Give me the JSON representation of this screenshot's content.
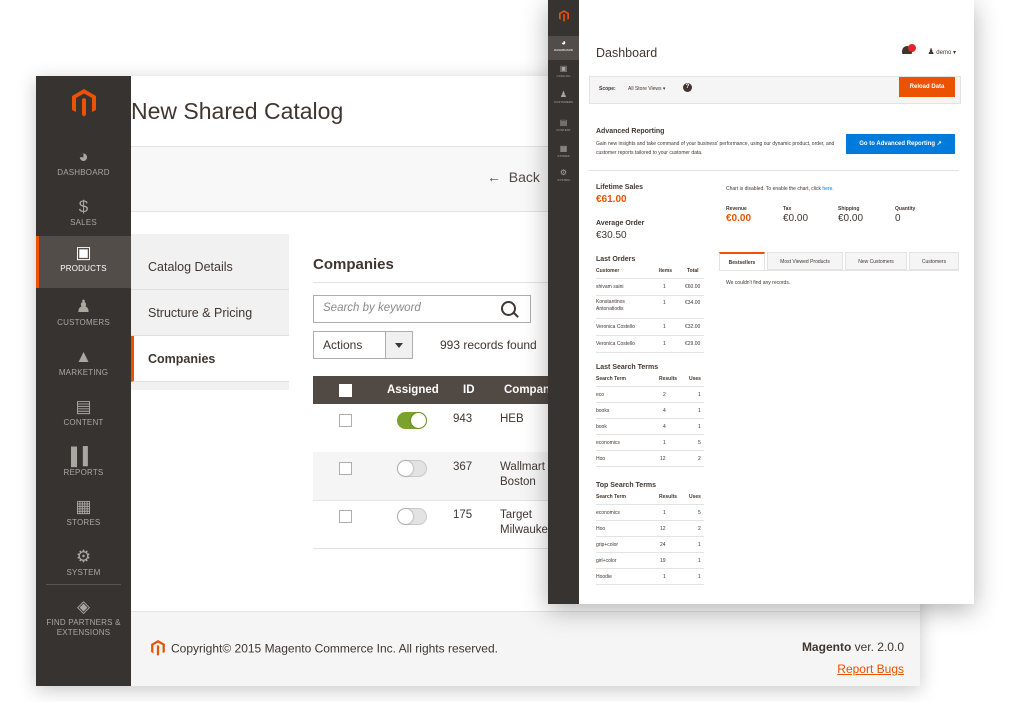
{
  "catalog_window": {
    "title": "New Shared Catalog",
    "back_label": "Back",
    "nav": [
      {
        "label": "DASHBOARD",
        "icon": "dashboard-icon"
      },
      {
        "label": "SALES",
        "icon": "dollar-icon"
      },
      {
        "label": "PRODUCTS",
        "icon": "cube-icon"
      },
      {
        "label": "CUSTOMERS",
        "icon": "person-icon"
      },
      {
        "label": "MARKETING",
        "icon": "megaphone-icon"
      },
      {
        "label": "CONTENT",
        "icon": "content-icon"
      },
      {
        "label": "REPORTS",
        "icon": "bar-chart-icon"
      },
      {
        "label": "STORES",
        "icon": "store-icon"
      },
      {
        "label": "SYSTEM",
        "icon": "gear-icon"
      },
      {
        "label": "FIND PARTNERS & EXTENSIONS",
        "icon": "puzzle-icon"
      }
    ],
    "tabs": [
      {
        "label": "Catalog Details"
      },
      {
        "label": "Structure & Pricing"
      },
      {
        "label": "Companies"
      }
    ],
    "section_title": "Companies",
    "search_placeholder": "Search by keyword",
    "actions_label": "Actions",
    "records_found": "993 records found",
    "grid_headers": {
      "assigned": "Assigned",
      "id": "ID",
      "company": "Company"
    },
    "rows": [
      {
        "assigned": true,
        "id": "943",
        "company": "HEB"
      },
      {
        "assigned": false,
        "id": "367",
        "company": "Wallmart Boston"
      },
      {
        "assigned": false,
        "id": "175",
        "company": "Target Milwaukee"
      }
    ],
    "footer": {
      "copyright": "Copyright© 2015 Magento Commerce Inc. All rights reserved.",
      "brand": "Magento",
      "version": "ver. 2.0.0",
      "report_bugs": "Report Bugs"
    }
  },
  "dashboard_window": {
    "title": "Dashboard",
    "user": "demo",
    "nav": [
      {
        "label": "DASHBOARD"
      },
      {
        "label": "CATALOG"
      },
      {
        "label": "CUSTOMERS"
      },
      {
        "label": "CONTENT"
      },
      {
        "label": "STORES"
      },
      {
        "label": "SYSTEM"
      }
    ],
    "scope_label": "Scope:",
    "scope_value": "All Store Views",
    "reload_label": "Reload Data",
    "advanced": {
      "title": "Advanced Reporting",
      "text": "Gain new insights and take command of your business' performance, using our dynamic product, order, and customer reports tailored to your customer data.",
      "button": "Go to Advanced Reporting"
    },
    "lifetime_sales_label": "Lifetime Sales",
    "lifetime_sales_value": "€61.00",
    "average_order_label": "Average Order",
    "average_order_value": "€30.50",
    "chart_disabled_text": "Chart is disabled. To enable the chart, click",
    "chart_disabled_link": "here.",
    "totals": [
      {
        "label": "Revenue",
        "value": "€0.00"
      },
      {
        "label": "Tax",
        "value": "€0.00"
      },
      {
        "label": "Shipping",
        "value": "€0.00"
      },
      {
        "label": "Quantity",
        "value": "0"
      }
    ],
    "last_orders": {
      "title": "Last Orders",
      "headers": [
        "Customer",
        "Items",
        "Total"
      ],
      "rows": [
        [
          "shivam saini",
          "1",
          "€60.00"
        ],
        [
          "Konstantinos Antonatiodis",
          "1",
          "€34.00"
        ],
        [
          "Veronica Costello",
          "1",
          "€32.00"
        ],
        [
          "Veronica Costello",
          "1",
          "€29.00"
        ]
      ]
    },
    "last_search": {
      "title": "Last Search Terms",
      "headers": [
        "Search Term",
        "Results",
        "Uses"
      ],
      "rows": [
        [
          "eco",
          "2",
          "1"
        ],
        [
          "books",
          "4",
          "1"
        ],
        [
          "book",
          "4",
          "1"
        ],
        [
          "economics",
          "1",
          "5"
        ],
        [
          "Hoo",
          "12",
          "2"
        ]
      ]
    },
    "top_search": {
      "title": "Top Search Terms",
      "headers": [
        "Search Term",
        "Results",
        "Uses"
      ],
      "rows": [
        [
          "economics",
          "1",
          "5"
        ],
        [
          "Hoo",
          "12",
          "2"
        ],
        [
          "grip+color",
          "24",
          "1"
        ],
        [
          "girl+color",
          "19",
          "1"
        ],
        [
          "Hoodie",
          "1",
          "1"
        ]
      ]
    },
    "tabs": [
      "Bestsellers",
      "Most Viewed Products",
      "New Customers",
      "Customers"
    ],
    "no_records": "We couldn't find any records."
  }
}
